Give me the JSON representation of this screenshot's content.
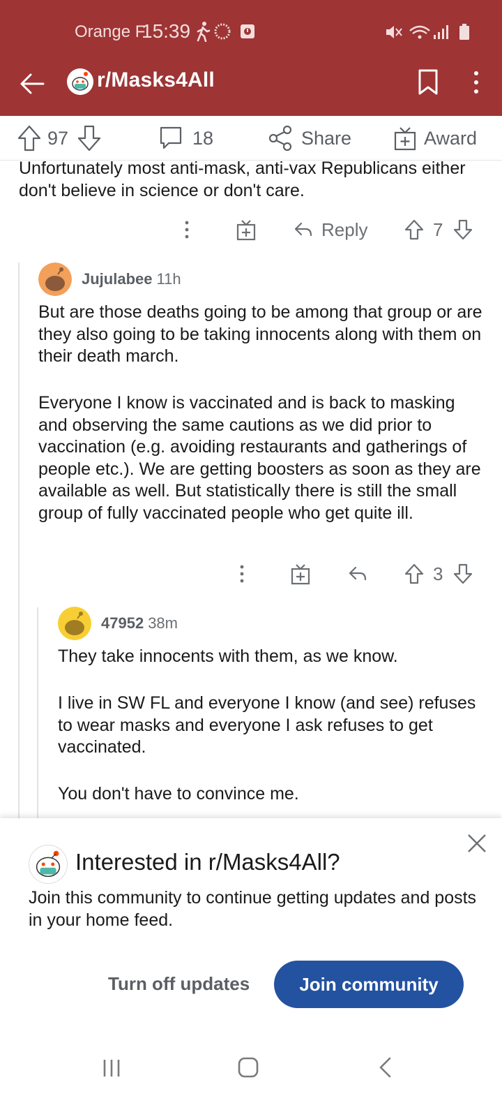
{
  "status_bar": {
    "carrier": "Orange F",
    "time": "15:39"
  },
  "app_bar": {
    "subreddit": "r/Masks4All"
  },
  "post_actions": {
    "upvotes": "97",
    "comments": "18",
    "share_label": "Share",
    "award_label": "Award"
  },
  "comments": [
    {
      "text": "Unfortunately most anti-mask, anti-vax Republicans either don't believe in science or don't care.",
      "reply_label": "Reply",
      "score": "7"
    },
    {
      "username": "Jujulabee",
      "age": "11h",
      "paragraphs": [
        "But are those deaths going to be among that group or are they also going to be taking innocents along with them on their death march.",
        "Everyone I know is vaccinated and is back to masking and observing the same cautions as we did prior to vaccination (e.g. avoiding restaurants and gatherings of people etc.). We are getting boosters as soon as they are available as well. But statistically there is still the small group of fully vaccinated people who get quite ill."
      ],
      "score": "3",
      "avatar_color": "#f3a05a"
    },
    {
      "username": "47952",
      "age": "38m",
      "paragraphs": [
        "They take innocents with them, as we know.",
        "I live in SW FL and everyone I know (and see) refuses to wear masks and everyone I ask refuses to get vaccinated.",
        "You don't have to convince me."
      ],
      "avatar_color": "#f7cf35"
    }
  ],
  "bottom_sheet": {
    "title": "Interested in r/Masks4All?",
    "body": "Join this community to continue getting updates and posts in your home feed.",
    "turn_off_label": "Turn off updates",
    "join_label": "Join community"
  },
  "colors": {
    "header_bg": "#9e3434",
    "join_button": "#2352a0"
  }
}
